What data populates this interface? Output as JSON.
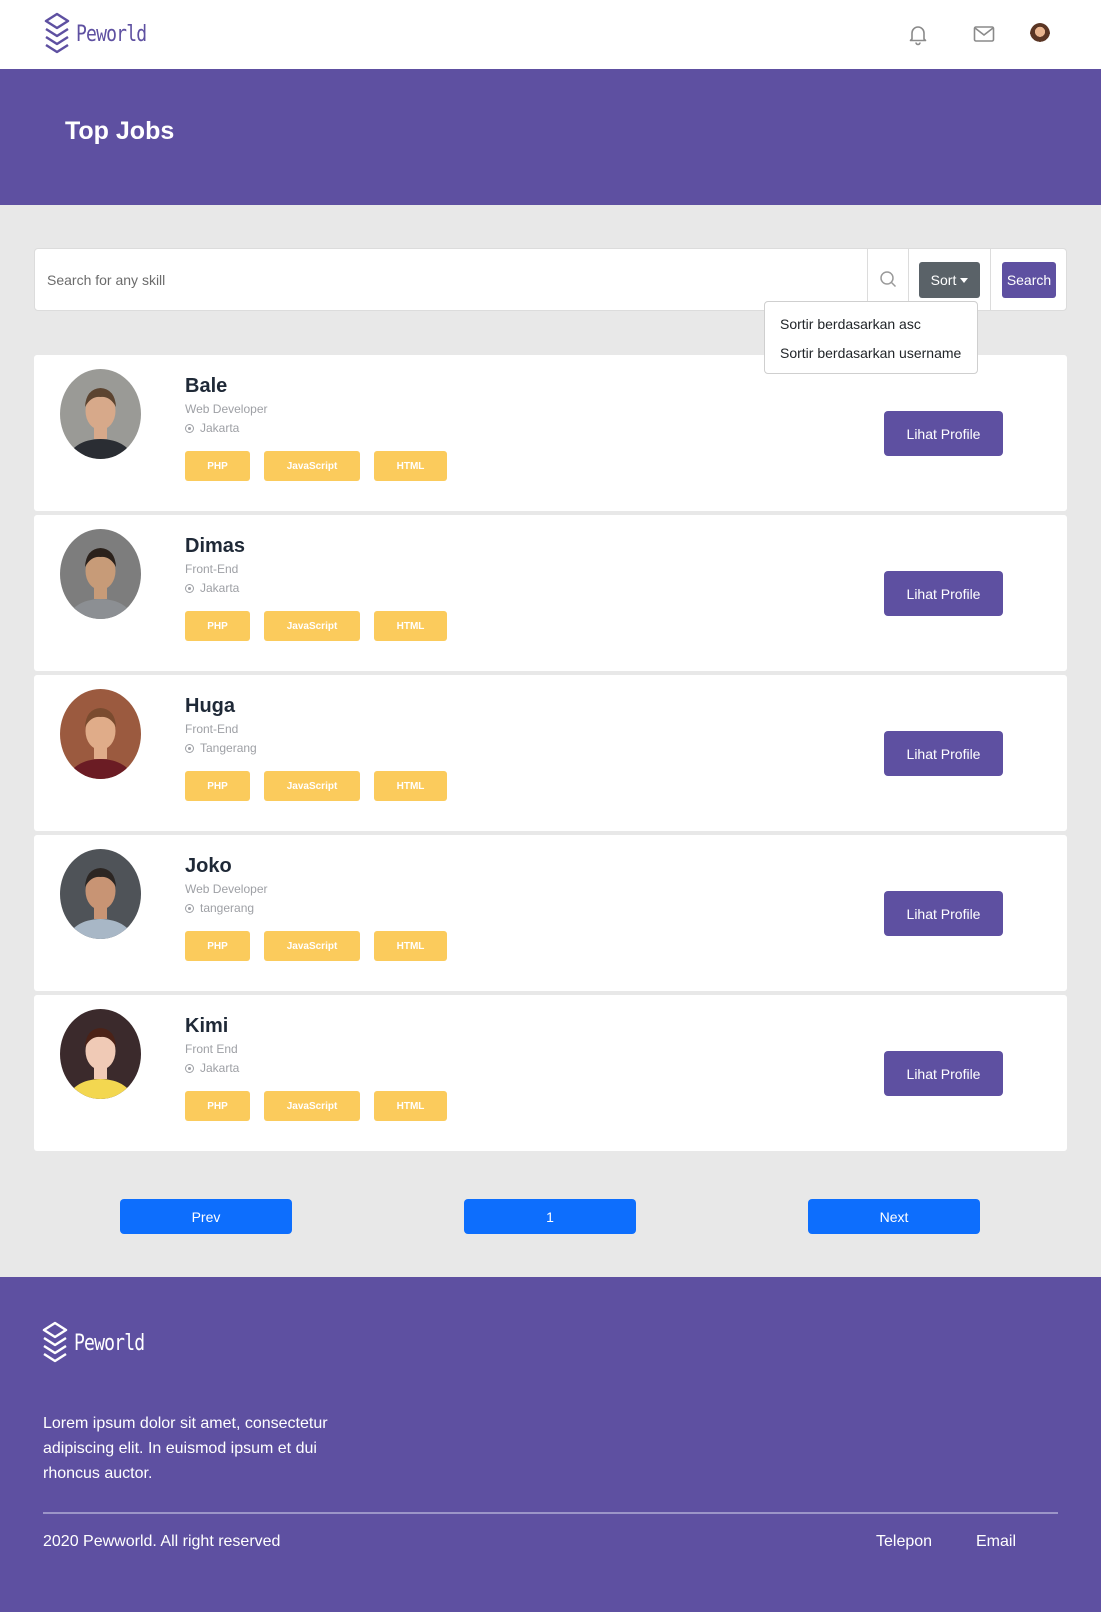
{
  "brand": {
    "name": "Peworld"
  },
  "hero": {
    "title": "Top Jobs"
  },
  "search": {
    "placeholder": "Search for any skill",
    "sort_label": "Sort",
    "search_label": "Search",
    "sort_options": [
      "Sortir berdasarkan asc",
      "Sortir berdasarkan username"
    ]
  },
  "colors": {
    "primary": "#5e50a1",
    "skill": "#fbcb5c",
    "page_button": "#0d6efd",
    "sort_button": "#5a6268"
  },
  "cards": [
    {
      "name": "Bale",
      "role": "Web Developer",
      "location": "Jakarta",
      "skills": [
        "PHP",
        "JavaScript",
        "HTML"
      ],
      "button": "Lihat Profile"
    },
    {
      "name": "Dimas",
      "role": "Front-End",
      "location": "Jakarta",
      "skills": [
        "PHP",
        "JavaScript",
        "HTML"
      ],
      "button": "Lihat Profile"
    },
    {
      "name": "Huga",
      "role": "Front-End",
      "location": "Tangerang",
      "skills": [
        "PHP",
        "JavaScript",
        "HTML"
      ],
      "button": "Lihat Profile"
    },
    {
      "name": "Joko",
      "role": "Web Developer",
      "location": "tangerang",
      "skills": [
        "PHP",
        "JavaScript",
        "HTML"
      ],
      "button": "Lihat Profile"
    },
    {
      "name": "Kimi",
      "role": "Front End",
      "location": "Jakarta",
      "skills": [
        "PHP",
        "JavaScript",
        "HTML"
      ],
      "button": "Lihat Profile"
    }
  ],
  "pagination": {
    "prev": "Prev",
    "current": "1",
    "next": "Next"
  },
  "footer": {
    "description": "Lorem ipsum dolor sit amet, consectetur adipiscing elit. In euismod ipsum et dui rhoncus auctor.",
    "copyright": "2020 Pewworld. All right reserved",
    "links": [
      "Telepon",
      "Email"
    ]
  }
}
